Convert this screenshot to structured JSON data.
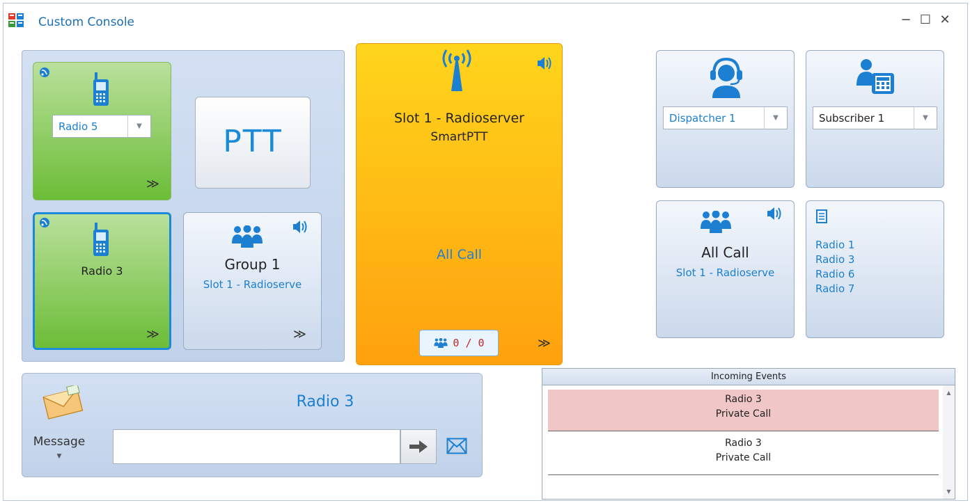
{
  "window": {
    "title": "Custom Console",
    "minimize_icon": "minimize-icon",
    "maximize_icon": "maximize-icon",
    "close_icon": "close-icon"
  },
  "tiles": {
    "radio5": {
      "selected": "Radio 5",
      "icon": "mobile-radio-icon"
    },
    "ptt": {
      "label": "PTT"
    },
    "radio3": {
      "label": "Radio 3",
      "icon": "mobile-radio-icon"
    },
    "group1": {
      "title": "Group 1",
      "subtitle": "Slot 1 - Radioserve",
      "icon": "group-icon"
    },
    "slot": {
      "line1": "Slot 1 - Radioserver",
      "line2": "SmartPTT",
      "call": "All Call",
      "counter": "0 / 0",
      "icon": "antenna-icon"
    },
    "dispatcher": {
      "selected": "Dispatcher 1",
      "icon": "headset-icon"
    },
    "subscriber": {
      "selected": "Subscriber 1",
      "icon": "phone-user-icon"
    },
    "allcall": {
      "title": "All Call",
      "subtitle": "Slot 1 - Radioserve",
      "icon": "group-icon"
    },
    "radiolist": {
      "items": [
        "Radio 1",
        "Radio 3",
        "Radio 6",
        "Radio 7"
      ],
      "icon": "list-icon"
    }
  },
  "message": {
    "recipient": "Radio 3",
    "label": "Message",
    "input_value": "",
    "send_icon": "arrow-right-icon",
    "mail_icon": "envelope-icon"
  },
  "events": {
    "title": "Incoming Events",
    "rows": [
      {
        "name": "Radio 3",
        "type": "Private Call",
        "highlight": true
      },
      {
        "name": "Radio 3",
        "type": "Private Call",
        "highlight": false
      }
    ]
  },
  "colors": {
    "accent": "#1c7fd1",
    "green_tile": "#6cbd37",
    "orange_tile": "#ffa10e",
    "event_highlight": "#f1c6c6"
  }
}
